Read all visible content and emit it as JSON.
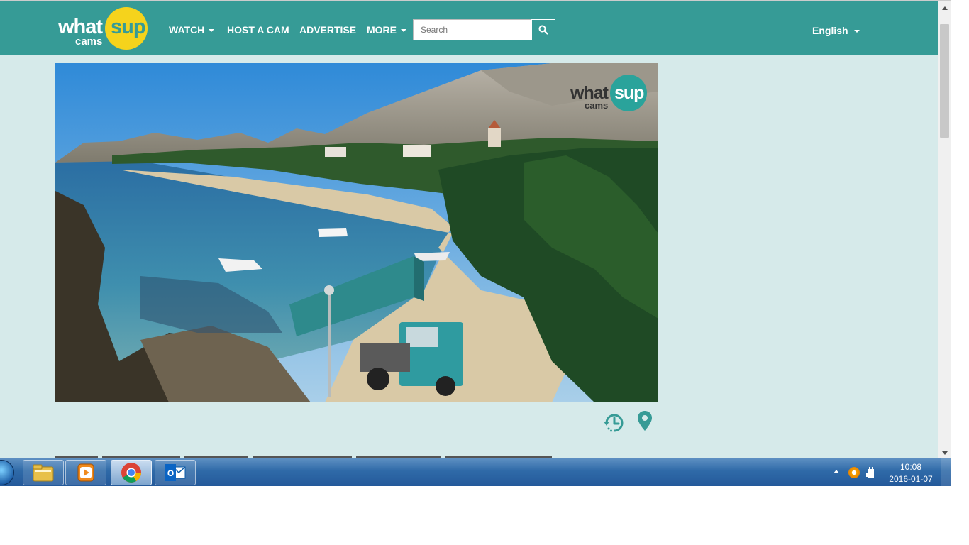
{
  "site": {
    "logo": {
      "word1": "what",
      "word2": "sup",
      "word3": "cams"
    },
    "nav": [
      {
        "label": "WATCH",
        "has_caret": true
      },
      {
        "label": "HOST A CAM",
        "has_caret": false
      },
      {
        "label": "ADVERTISE",
        "has_caret": false
      },
      {
        "label": "MORE",
        "has_caret": true
      }
    ],
    "search": {
      "placeholder": "Search",
      "icon": "magnifier-icon"
    },
    "language": "English",
    "colors": {
      "header": "#369b96",
      "page_bg": "#d6eaea",
      "logo_yellow": "#f5d31c"
    }
  },
  "video": {
    "watermark": {
      "word1": "what",
      "word2": "sup",
      "word3": "cams"
    },
    "controls": [
      {
        "icon": "history-clock-icon"
      },
      {
        "icon": "map-pin-icon"
      }
    ]
  },
  "taskbar": {
    "apps": [
      {
        "name": "Windows Explorer",
        "icon": "folder-icon"
      },
      {
        "name": "Media Player",
        "icon": "media-player-icon"
      },
      {
        "name": "Google Chrome",
        "icon": "chrome-icon",
        "active": true
      },
      {
        "name": "Outlook",
        "icon": "outlook-icon"
      }
    ],
    "clock": {
      "time": "10:08",
      "date": "2016-01-07"
    }
  }
}
